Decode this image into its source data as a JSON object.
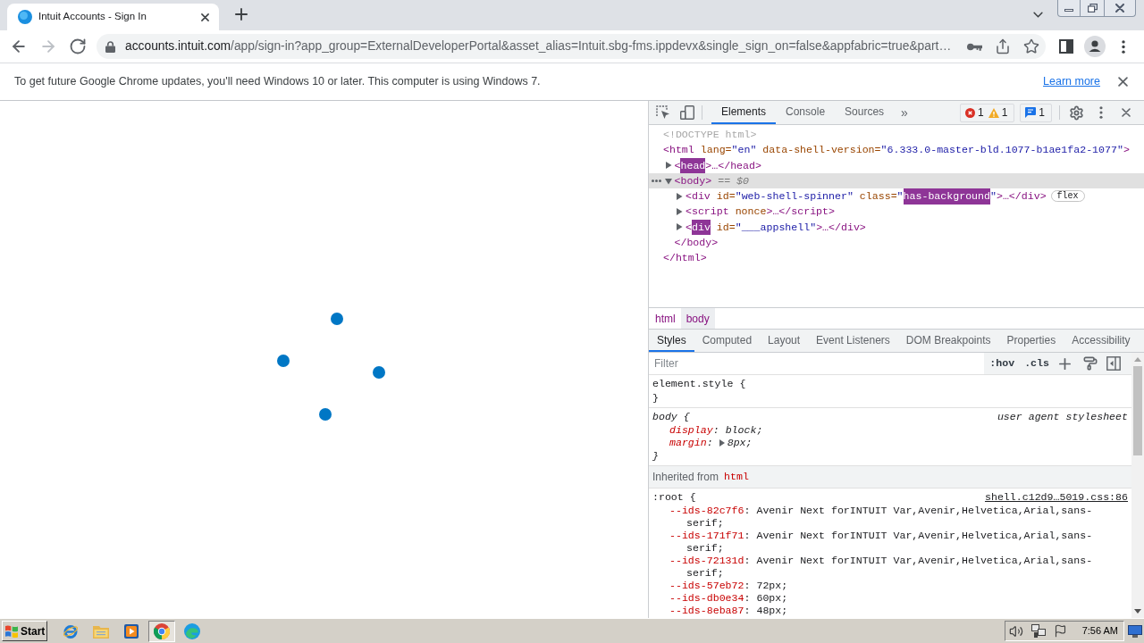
{
  "browser": {
    "tabs": [
      {
        "title": "Intuit Accounts - Sign In",
        "selected": true
      }
    ],
    "nav_buttons": [
      {
        "kind": "back",
        "disabled": false
      },
      {
        "kind": "forward",
        "disabled": true
      },
      {
        "kind": "reload",
        "disabled": false
      }
    ],
    "address_bar": {
      "host": "accounts.intuit.com",
      "path": "/app/sign-in?app_group=ExternalDeveloperPortal&asset_alias=Intuit.sbg-fms.ippdevx&single_sign_on=false&appfabric=true&part…"
    },
    "infobar": {
      "message": "To get future Google Chrome updates, you'll need Windows 10 or later. This computer is using Windows 7.",
      "link": "Learn more"
    }
  },
  "devtools": {
    "tabs": [
      {
        "label": "Elements",
        "selected": true
      },
      {
        "label": "Console",
        "selected": false
      },
      {
        "label": "Sources",
        "selected": false
      }
    ],
    "more_tabs": "»",
    "issue_buttons": [
      {
        "counts": [
          {
            "kind": "error",
            "count": "1"
          },
          {
            "kind": "warning",
            "count": "1"
          }
        ]
      },
      {
        "counts": [
          {
            "kind": "message",
            "count": "1"
          }
        ]
      }
    ],
    "dom_tree": [
      {
        "selected": false,
        "tokens": [
          {
            "kind": "doctype",
            "text": "<!DOCTYPE html>"
          }
        ]
      },
      {
        "selected": false,
        "tokens": [
          {
            "kind": "tag",
            "text": "<html"
          },
          {
            "kind": "attr",
            "text": " lang="
          },
          {
            "kind": "value",
            "text": "\"en\""
          },
          {
            "kind": "attr",
            "text": " data-shell-version="
          },
          {
            "kind": "value",
            "text": "\"6.333.0-master-bld.1077-b1ae1fa2-1077\""
          },
          {
            "kind": "tag",
            "text": ">"
          }
        ],
        "children": [
          {
            "selected": false,
            "expanded": false,
            "tokens": [
              {
                "kind": "tag",
                "text": "<"
              },
              {
                "kind": "match",
                "text": "head"
              },
              {
                "kind": "tag",
                "text": ">…</head>"
              }
            ]
          },
          {
            "selected": true,
            "expanded": true,
            "tokens": [
              {
                "kind": "tag",
                "text": "<body>"
              },
              {
                "kind": "note",
                "text": " == $0"
              }
            ],
            "children": [
              {
                "selected": false,
                "expanded": false,
                "tokens": [
                  {
                    "kind": "tag",
                    "text": "<div"
                  },
                  {
                    "kind": "attr",
                    "text": " id="
                  },
                  {
                    "kind": "value",
                    "text": "\"web-shell-spinner\""
                  },
                  {
                    "kind": "attr",
                    "text": " class="
                  },
                  {
                    "kind": "value",
                    "text": "\""
                  },
                  {
                    "kind": "match",
                    "text": "has-background"
                  },
                  {
                    "kind": "value",
                    "text": "\""
                  },
                  {
                    "kind": "tag",
                    "text": ">…</div>"
                  }
                ],
                "badge": "flex"
              },
              {
                "selected": false,
                "expanded": false,
                "tokens": [
                  {
                    "kind": "tag",
                    "text": "<script"
                  },
                  {
                    "kind": "attr",
                    "text": " nonce"
                  },
                  {
                    "kind": "tag",
                    "text": ">…</script>"
                  }
                ]
              },
              {
                "selected": false,
                "expanded": false,
                "tokens": [
                  {
                    "kind": "tag",
                    "text": "<"
                  },
                  {
                    "kind": "match",
                    "text": "div"
                  },
                  {
                    "kind": "attr",
                    "text": " id="
                  },
                  {
                    "kind": "value",
                    "text": "\"___appshell\""
                  },
                  {
                    "kind": "tag",
                    "text": ">…</div>"
                  }
                ]
              }
            ],
            "closing": [
              {
                "kind": "tag",
                "text": "</body>"
              }
            ]
          }
        ],
        "closing": [
          {
            "kind": "tag",
            "text": "</html>"
          }
        ]
      }
    ],
    "breadcrumbs": [
      {
        "label": "html",
        "selected": false
      },
      {
        "label": "body",
        "selected": true
      }
    ],
    "style_tabs": [
      {
        "label": "Styles",
        "selected": true
      },
      {
        "label": "Computed",
        "selected": false
      },
      {
        "label": "Layout",
        "selected": false
      },
      {
        "label": "Event Listeners",
        "selected": false
      },
      {
        "label": "DOM Breakpoints",
        "selected": false
      },
      {
        "label": "Properties",
        "selected": false
      },
      {
        "label": "Accessibility",
        "selected": false
      }
    ],
    "filter": {
      "placeholder": "Filter"
    },
    "filter_toggles": [
      ":hov",
      ".cls"
    ],
    "rules": [
      {
        "kind": "rule",
        "selector": "element.style {",
        "user_agent": false,
        "close": "}"
      },
      {
        "kind": "rule",
        "selector": "body {",
        "source": "user agent stylesheet",
        "user_agent": true,
        "declarations": [
          {
            "kind": "longhand",
            "property": "display",
            "colon": ":",
            "value": "block;"
          },
          {
            "kind": "shorthand",
            "property": "margin",
            "colon": ":",
            "value": "8px;"
          }
        ],
        "close": "}"
      },
      {
        "kind": "inherited",
        "label": "Inherited from",
        "selector": "html"
      },
      {
        "kind": "rule",
        "selector": ":root {",
        "source": "shell.c12d9…5019.css:86",
        "user_agent": false,
        "declarations": [
          {
            "kind": "longhand",
            "property": "--ids-82c7f6",
            "colon": ":",
            "value": "Avenir Next forINTUIT Var,Avenir,Helvetica,Arial,sans-serif;"
          },
          {
            "kind": "longhand",
            "property": "--ids-171f71",
            "colon": ":",
            "value": "Avenir Next forINTUIT Var,Avenir,Helvetica,Arial,sans-serif;"
          },
          {
            "kind": "longhand",
            "property": "--ids-72131d",
            "colon": ":",
            "value": "Avenir Next forINTUIT Var,Avenir,Helvetica,Arial,sans-serif;"
          },
          {
            "kind": "longhand",
            "property": "--ids-57eb72",
            "colon": ":",
            "value": "72px;"
          },
          {
            "kind": "longhand",
            "property": "--ids-db0e34",
            "colon": ":",
            "value": "60px;"
          },
          {
            "kind": "longhand",
            "property": "--ids-8eba87",
            "colon": ":",
            "value": "48px;"
          }
        ]
      }
    ]
  },
  "taskbar": {
    "start": "Start",
    "apps": [
      {
        "kind": "ie",
        "selected": false
      },
      {
        "kind": "folder",
        "selected": false
      },
      {
        "kind": "media",
        "selected": false
      },
      {
        "kind": "chrome",
        "selected": true
      },
      {
        "kind": "edge",
        "selected": false
      }
    ],
    "tray": [
      {
        "kind": "speaker"
      },
      {
        "kind": "network"
      },
      {
        "kind": "flag"
      }
    ],
    "clock": "7:56 AM"
  }
}
